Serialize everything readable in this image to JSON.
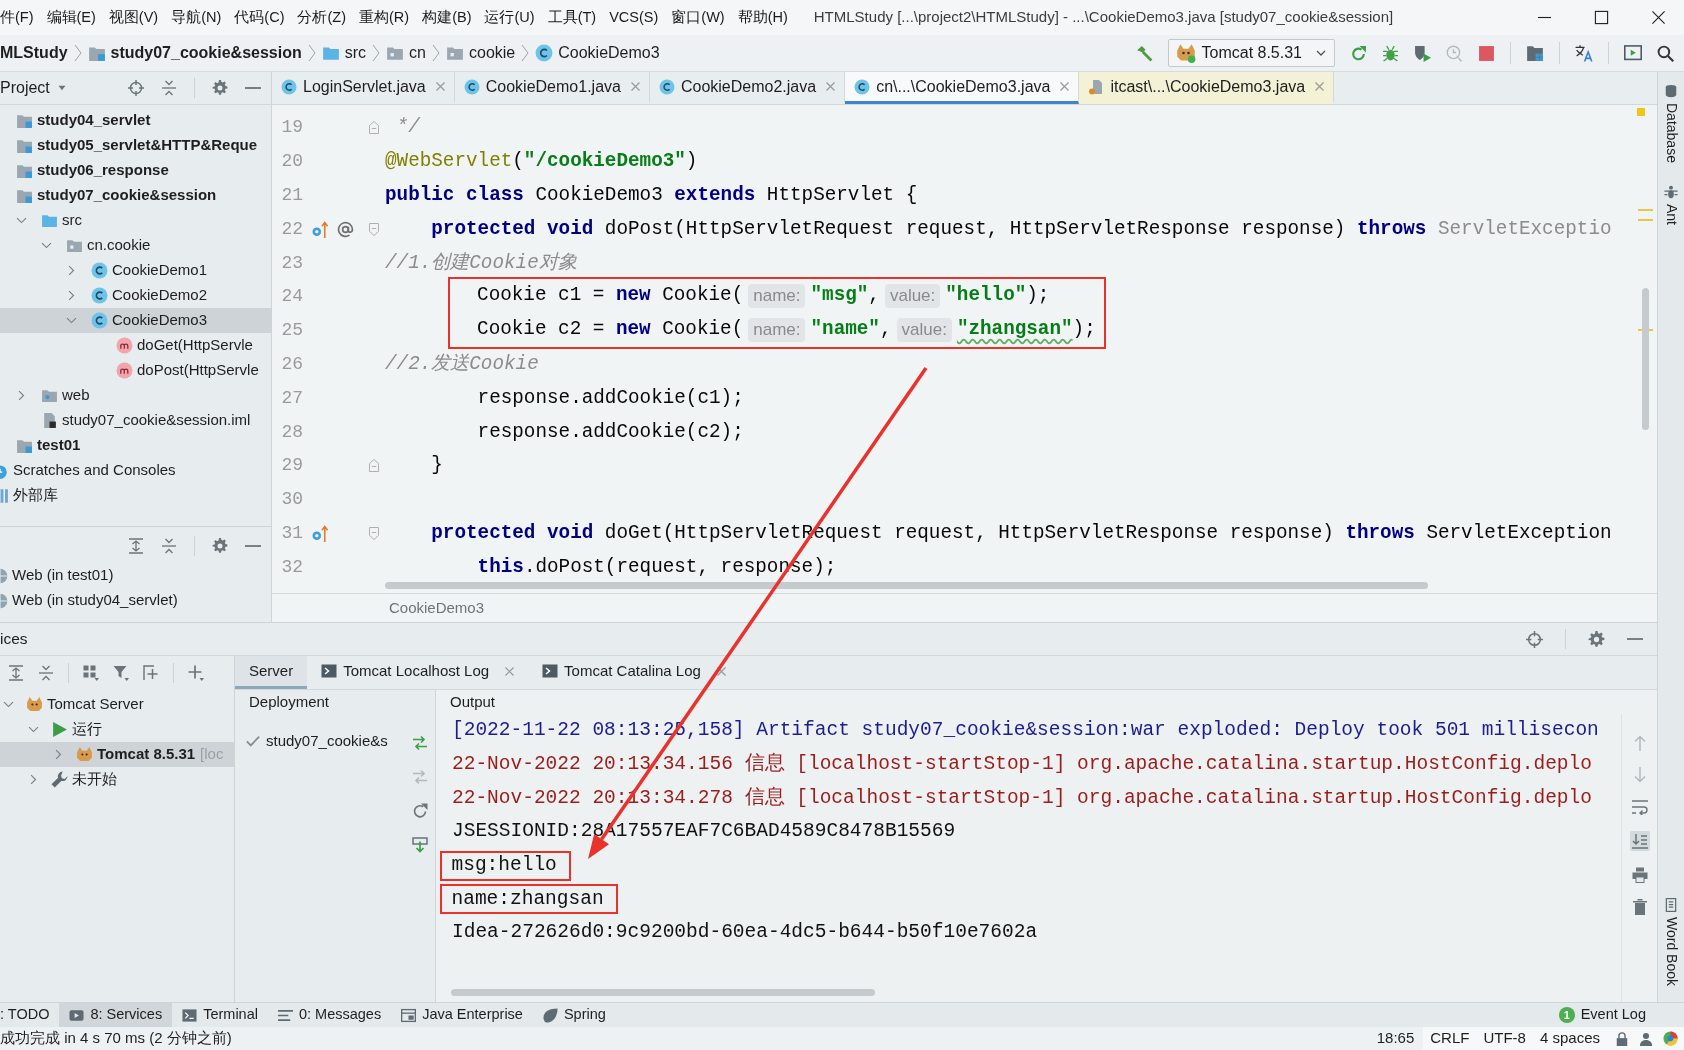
{
  "window": {
    "title": "HTMLStudy [...\\project2\\HTMLStudy] - ...\\CookieDemo3.java [study07_cookie&session]",
    "menu": [
      "件(F)",
      "编辑(E)",
      "视图(V)",
      "导航(N)",
      "代码(C)",
      "分析(Z)",
      "重构(R)",
      "构建(B)",
      "运行(U)",
      "工具(T)",
      "VCS(S)",
      "窗口(W)",
      "帮助(H)"
    ]
  },
  "navigation_bar": {
    "breadcrumbs": [
      {
        "label": "MLStudy",
        "kind": "project"
      },
      {
        "label": "study07_cookie&session",
        "kind": "module"
      },
      {
        "label": "src",
        "kind": "source_folder"
      },
      {
        "label": "cn",
        "kind": "package"
      },
      {
        "label": "cookie",
        "kind": "package"
      },
      {
        "label": "CookieDemo3",
        "kind": "class"
      }
    ],
    "run_configuration": "Tomcat 8.5.31"
  },
  "project_panel": {
    "title": "Project",
    "module_nodes": [
      {
        "label": "study04_servlet",
        "kind": "module",
        "selected": false
      },
      {
        "label": "study05_servlet&HTTP&Reque",
        "kind": "module",
        "selected": false
      },
      {
        "label": "study06_response",
        "kind": "module",
        "selected": false
      },
      {
        "label": "study07_cookie&session",
        "kind": "module",
        "selected": false,
        "children": [
          {
            "label": "src",
            "kind": "source_folder",
            "expanded": true,
            "selected": false,
            "children": [
              {
                "label": "cn.cookie",
                "kind": "package",
                "expanded": true,
                "selected": false,
                "children": [
                  {
                    "label": "CookieDemo1",
                    "kind": "class",
                    "expanded": false,
                    "selected": false
                  },
                  {
                    "label": "CookieDemo2",
                    "kind": "class",
                    "expanded": false,
                    "selected": false
                  },
                  {
                    "label": "CookieDemo3",
                    "kind": "class",
                    "expanded": true,
                    "selected": true,
                    "children": [
                      {
                        "label": "doGet(HttpServle",
                        "kind": "method",
                        "selected": false
                      },
                      {
                        "label": "doPost(HttpServle",
                        "kind": "method",
                        "selected": false
                      }
                    ]
                  }
                ]
              }
            ]
          },
          {
            "label": "web",
            "kind": "web_folder",
            "expanded": false,
            "selected": false
          },
          {
            "label": "study07_cookie&session.iml",
            "kind": "module_file",
            "selected": false
          }
        ]
      },
      {
        "label": "test01",
        "kind": "module",
        "selected": false
      }
    ],
    "top_nodes": [
      {
        "label": "Scratches and Consoles",
        "kind": "scratches",
        "selected": false
      },
      {
        "label": "外部库",
        "kind": "libraries",
        "selected": false
      }
    ]
  },
  "web_panel": {
    "items": [
      "Web (in test01)",
      "Web (in study04_servlet)"
    ]
  },
  "editor": {
    "tabs": [
      {
        "label": "LoginServlet.java",
        "kind": "class",
        "selected": false
      },
      {
        "label": "CookieDemo1.java",
        "kind": "class",
        "selected": false
      },
      {
        "label": "CookieDemo2.java",
        "kind": "class",
        "selected": false
      },
      {
        "label": "cn\\...\\CookieDemo3.java",
        "kind": "class",
        "selected": true
      },
      {
        "label": "itcast\\...\\CookieDemo3.java",
        "kind": "external",
        "selected": false
      }
    ],
    "lines": [
      {
        "number": "19",
        "fold_marker": {
          "kind": "end"
        },
        "boxed": false,
        "tokens": [
          {
            "text": " */",
            "kind": "comment"
          }
        ]
      },
      {
        "number": "20",
        "boxed": false,
        "tokens": [
          {
            "text": "@WebServlet",
            "kind": "annotation"
          },
          {
            "text": "(",
            "kind": "plain"
          },
          {
            "text": "\"/cookieDemo3\"",
            "kind": "string"
          },
          {
            "text": ")",
            "kind": "plain"
          }
        ]
      },
      {
        "number": "21",
        "boxed": false,
        "tokens": [
          {
            "text": "public class",
            "kind": "keyword"
          },
          {
            "text": " CookieDemo3 ",
            "kind": "plain"
          },
          {
            "text": "extends",
            "kind": "keyword"
          },
          {
            "text": " HttpServlet {",
            "kind": "plain"
          }
        ]
      },
      {
        "number": "22",
        "gutter_icons": [
          {
            "kind": "override"
          },
          {
            "kind": "mapping"
          }
        ],
        "fold_marker": {
          "kind": "start"
        },
        "boxed": false,
        "tokens": [
          {
            "text": "    protected void",
            "kind": "keyword"
          },
          {
            "text": " doPost(HttpServletRequest request, HttpServletResponse response) ",
            "kind": "plain"
          },
          {
            "text": "throws",
            "kind": "keyword"
          },
          {
            "text": " ServletExceptio",
            "kind": "dim"
          }
        ]
      },
      {
        "number": "23",
        "boxed": false,
        "tokens": [
          {
            "text": "//1.创建Cookie对象",
            "kind": "comment"
          }
        ]
      },
      {
        "number": "24",
        "boxed": true,
        "tokens": [
          {
            "text": "        Cookie c1 = ",
            "kind": "plain"
          },
          {
            "text": "new",
            "kind": "keyword"
          },
          {
            "text": " Cookie(",
            "kind": "plain"
          },
          {
            "text": "name:",
            "kind": "hint"
          },
          {
            "text": "\"msg\"",
            "kind": "string"
          },
          {
            "text": ",",
            "kind": "plain"
          },
          {
            "text": "value:",
            "kind": "hint"
          },
          {
            "text": "\"hello\"",
            "kind": "string"
          },
          {
            "text": ");",
            "kind": "plain"
          }
        ]
      },
      {
        "number": "25",
        "boxed": true,
        "tokens": [
          {
            "text": "        Cookie c2 = ",
            "kind": "plain"
          },
          {
            "text": "new",
            "kind": "keyword"
          },
          {
            "text": " Cookie(",
            "kind": "plain"
          },
          {
            "text": "name:",
            "kind": "hint"
          },
          {
            "text": "\"name\"",
            "kind": "string"
          },
          {
            "text": ",",
            "kind": "plain"
          },
          {
            "text": "value:",
            "kind": "hint"
          },
          {
            "text": "\"zhangsan\"",
            "kind": "string",
            "misspelled": true
          },
          {
            "text": ");",
            "kind": "plain"
          }
        ]
      },
      {
        "number": "26",
        "boxed": false,
        "tokens": [
          {
            "text": "//2.发送Cookie",
            "kind": "comment"
          }
        ]
      },
      {
        "number": "27",
        "boxed": false,
        "tokens": [
          {
            "text": "        response.addCookie(c1);",
            "kind": "plain"
          }
        ]
      },
      {
        "number": "28",
        "boxed": false,
        "tokens": [
          {
            "text": "        response.addCookie(c2);",
            "kind": "plain"
          }
        ]
      },
      {
        "number": "29",
        "fold_marker": {
          "kind": "end"
        },
        "boxed": false,
        "tokens": [
          {
            "text": "    }",
            "kind": "plain"
          }
        ]
      },
      {
        "number": "30",
        "boxed": false
      },
      {
        "number": "31",
        "gutter_icons": [
          {
            "kind": "override"
          }
        ],
        "fold_marker": {
          "kind": "start"
        },
        "boxed": false,
        "tokens": [
          {
            "text": "    protected void",
            "kind": "keyword"
          },
          {
            "text": " doGet(HttpServletRequest request, HttpServletResponse response) ",
            "kind": "plain"
          },
          {
            "text": "throws",
            "kind": "keyword"
          },
          {
            "text": " ServletException",
            "kind": "plain"
          }
        ]
      },
      {
        "number": "32",
        "boxed": false,
        "tokens": [
          {
            "text": "        this",
            "kind": "keyword"
          },
          {
            "text": ".doPost(request, response);",
            "kind": "plain"
          }
        ]
      }
    ],
    "breadcrumb": "CookieDemo3"
  },
  "services": {
    "title": "ices",
    "tree": [
      {
        "label": "Tomcat Server",
        "kind": "server",
        "expanded": true,
        "selected": false,
        "children": [
          {
            "label": "运行",
            "kind": "running",
            "expanded": true,
            "selected": false,
            "children": [
              {
                "label": "Tomcat 8.5.31",
                "suffix": "[loc",
                "kind": "tomcat_instance",
                "expanded": false,
                "selected": true
              }
            ]
          },
          {
            "label": "未开始",
            "kind": "not_started",
            "expanded": false,
            "selected": false
          }
        ]
      }
    ],
    "tabs": [
      {
        "label": "Server",
        "kind": "plain",
        "selected": true
      },
      {
        "label": "Tomcat Localhost Log",
        "kind": "log",
        "selected": false
      },
      {
        "label": "Tomcat Catalina Log",
        "kind": "log",
        "selected": false
      }
    ],
    "deployment": {
      "header": "Deployment",
      "items": [
        "study07_cookie&s"
      ]
    },
    "output": {
      "header": "Output",
      "lines": [
        {
          "text": "[2022-11-22 08:13:25,158] Artifact study07_cookie&session:war exploded: Deploy took 501 millisecon",
          "kind": "system",
          "boxed": false
        },
        {
          "text": "22-Nov-2022 20:13:34.156 信息 [localhost-startStop-1] org.apache.catalina.startup.HostConfig.deplo",
          "kind": "log",
          "boxed": false
        },
        {
          "text": "22-Nov-2022 20:13:34.278 信息 [localhost-startStop-1] org.apache.catalina.startup.HostConfig.deplo",
          "kind": "log",
          "boxed": false
        },
        {
          "text": "JSESSIONID:28A17557EAF7C6BAD4589C8478B15569",
          "kind": "stdout",
          "boxed": false
        },
        {
          "text": "msg:hello",
          "kind": "stdout",
          "boxed": true
        },
        {
          "text": "name:zhangsan",
          "kind": "stdout",
          "boxed": true
        },
        {
          "text": "Idea-272626d0:9c9200bd-60ea-4dc5-b644-b50f10e7602a",
          "kind": "stdout",
          "boxed": false
        }
      ]
    }
  },
  "right_strip": {
    "top": [
      {
        "label": "Database",
        "kind": "database"
      },
      {
        "label": "Ant",
        "kind": "ant"
      }
    ],
    "bottom": [
      {
        "label": "Word Book",
        "kind": "word_book"
      }
    ]
  },
  "tool_windows": [
    {
      "label": ": TODO",
      "kind": "todo",
      "selected": false
    },
    {
      "label": "8: Services",
      "kind": "services",
      "selected": true
    },
    {
      "label": "Terminal",
      "kind": "terminal",
      "selected": false
    },
    {
      "label": "0: Messages",
      "kind": "messages",
      "selected": false
    },
    {
      "label": "Java Enterprise",
      "kind": "java_enterprise",
      "selected": false
    },
    {
      "label": "Spring",
      "kind": "spring",
      "selected": false
    }
  ],
  "event_log": {
    "badge": "1",
    "label": "Event Log"
  },
  "status_bar": {
    "message": "成功完成 in 4 s 70 ms (2 分钟之前)",
    "items": [
      "18:65",
      "CRLF",
      "UTF-8",
      "4 spaces"
    ]
  }
}
